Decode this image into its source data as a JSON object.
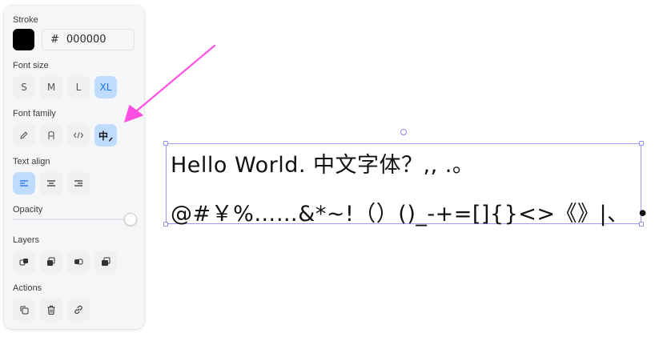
{
  "panel": {
    "stroke": {
      "label": "Stroke",
      "color": "#000000",
      "hash": "#",
      "hex_value": "000000"
    },
    "font_size": {
      "label": "Font size",
      "options": [
        "S",
        "M",
        "L",
        "XL"
      ],
      "selected": "XL"
    },
    "font_family": {
      "label": "Font family",
      "options": [
        "pencil-icon",
        "sans-serif-A-icon",
        "code-icon",
        "chinese-handwriting-icon"
      ],
      "selected_glyph": "中"
    },
    "text_align": {
      "label": "Text align",
      "options": [
        "align-left-icon",
        "align-center-icon",
        "align-right-icon"
      ],
      "selected": "align-left-icon"
    },
    "opacity": {
      "label": "Opacity",
      "value": 1.0
    },
    "layers": {
      "label": "Layers",
      "options": [
        "bring-to-front-icon",
        "bring-forward-icon",
        "send-backward-icon",
        "send-to-back-icon"
      ]
    },
    "actions": {
      "label": "Actions",
      "options": [
        "duplicate-icon",
        "delete-icon",
        "link-icon"
      ]
    }
  },
  "canvas": {
    "text_line_1": "Hello World. 中文字体？,,  .。",
    "text_line_2": "@#￥%……&*~!（）()_-+=[]{}<>《》|、 •",
    "accent_color": "#9b9bef",
    "annotation_arrow_color": "#ff4fe3"
  }
}
